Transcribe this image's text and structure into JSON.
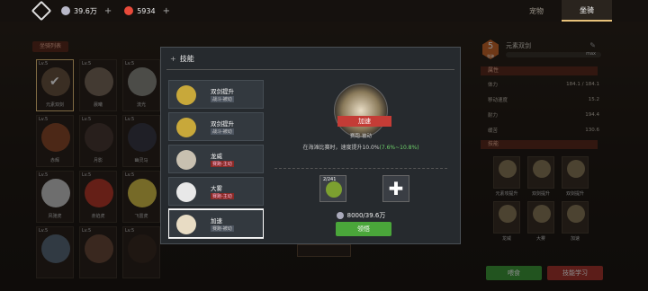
{
  "top": {
    "currency1": "39.6万",
    "currency2": "5934",
    "tabs": [
      "宠物",
      "坐骑"
    ],
    "active_tab": "坐骑"
  },
  "left": {
    "title": "坐骑列表",
    "mounts": [
      {
        "lv": "Lv.5",
        "name": "元素双剑",
        "color": "#6b5540",
        "sel": true
      },
      {
        "lv": "Lv.5",
        "name": "晨曦",
        "color": "#7a6a5c"
      },
      {
        "lv": "Lv.5",
        "name": "流光",
        "color": "#8a8a84"
      },
      {
        "lv": "Lv.5",
        "name": "赤辉",
        "color": "#8a4a2a"
      },
      {
        "lv": "Lv.5",
        "name": "月影",
        "color": "#4a3a34"
      },
      {
        "lv": "Lv.5",
        "name": "幽灵马",
        "color": "#3a3a46"
      },
      {
        "lv": "Lv.5",
        "name": "风驰虎",
        "color": "#c8c8c8"
      },
      {
        "lv": "Lv.5",
        "name": "赤焰虎",
        "color": "#b83a2a"
      },
      {
        "lv": "Lv.5",
        "name": "飞雷虎",
        "color": "#d8c24a"
      },
      {
        "lv": "Lv.5",
        "name": "",
        "color": "#5a6a7a"
      },
      {
        "lv": "Lv.5",
        "name": "",
        "color": "#6a4a3a"
      },
      {
        "lv": "Lv.5",
        "name": "",
        "color": "#3a2a22"
      }
    ]
  },
  "right": {
    "level": "5",
    "level_sub": "坐骑",
    "mount_name": "元素双剑",
    "max": "max",
    "attr_title": "属性",
    "attrs": [
      {
        "k": "体力",
        "v": "184.1 / 184.1"
      },
      {
        "k": "移动速度",
        "v": "15.2"
      },
      {
        "k": "耐力",
        "v": "194.4"
      },
      {
        "k": "缓苦",
        "v": "130.6"
      }
    ],
    "skill_title": "技能",
    "skills": [
      "元素攻提升",
      "双剑提升",
      "双剑提升",
      "龙威",
      "大雾",
      "加速"
    ],
    "feed": "喂食",
    "learn": "技能学习"
  },
  "modal": {
    "title": "技能",
    "list": [
      {
        "name": "双剑提升",
        "sub": "战斗-被动",
        "color": "#c8a83a",
        "red": false
      },
      {
        "name": "双剑提升",
        "sub": "战斗-被动",
        "color": "#c8a83a",
        "red": false
      },
      {
        "name": "龙威",
        "sub": "赛跑-主动",
        "color": "#c8c0b0",
        "red": true
      },
      {
        "name": "大雾",
        "sub": "赛跑-主动",
        "color": "#e8e8e8",
        "red": true
      },
      {
        "name": "加速",
        "sub": "赛跑-被动",
        "color": "#e8dcc4",
        "red": false,
        "active": true
      }
    ],
    "skill_name": "加速",
    "skill_type": "赛跑-被动",
    "desc": "在海滩比赛时，速度提升10.0%",
    "desc_green": "(7.6%~10.8%)",
    "mat_count": "2/241",
    "cost": "8000/39.6万",
    "learn": "领悟"
  }
}
